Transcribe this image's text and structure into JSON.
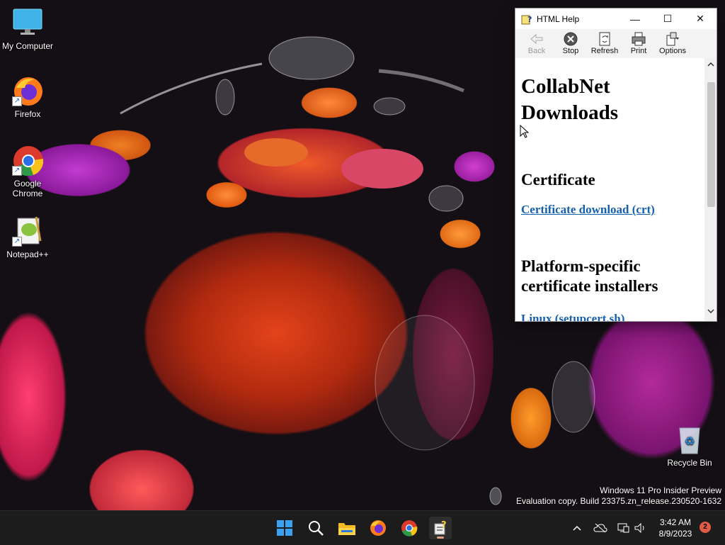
{
  "desktop": {
    "icons": [
      {
        "label": "My Computer",
        "icon": "monitor-icon"
      },
      {
        "label": "Firefox",
        "icon": "firefox-icon"
      },
      {
        "label": "Google Chrome",
        "icon": "chrome-icon"
      },
      {
        "label": "Notepad++",
        "icon": "notepadpp-icon"
      },
      {
        "label": "Recycle Bin",
        "icon": "recycle-bin-icon"
      }
    ]
  },
  "window": {
    "title": "HTML Help",
    "controls": {
      "minimize": "—",
      "maximize": "☐",
      "close": "✕"
    },
    "toolbar": [
      {
        "label": "Back",
        "icon": "back-arrow-icon",
        "enabled": false
      },
      {
        "label": "Stop",
        "icon": "stop-icon",
        "enabled": true
      },
      {
        "label": "Refresh",
        "icon": "refresh-icon",
        "enabled": true
      },
      {
        "label": "Print",
        "icon": "printer-icon",
        "enabled": true
      },
      {
        "label": "Options",
        "icon": "options-icon",
        "enabled": true
      }
    ],
    "content": {
      "heading": "CollabNet Downloads",
      "section1_title": "Certificate",
      "section1_link": "Certificate download (crt)",
      "section2_title": "Platform-specific certificate installers",
      "section2_link": "Linux (setupcert.sh)"
    }
  },
  "watermark": {
    "line1": "Windows 11 Pro Insider Preview",
    "line2": "Evaluation copy. Build 23375.zn_release.230520-1632"
  },
  "taskbar": {
    "apps": [
      "start-icon",
      "search-icon",
      "file-explorer-icon",
      "firefox-icon",
      "chrome-icon",
      "html-help-icon"
    ],
    "time": "3:42 AM",
    "date": "8/9/2023",
    "notifications": "2"
  },
  "colors": {
    "link": "#1660b0",
    "taskbar": "#1c1c1c",
    "badge": "#e05a44"
  }
}
